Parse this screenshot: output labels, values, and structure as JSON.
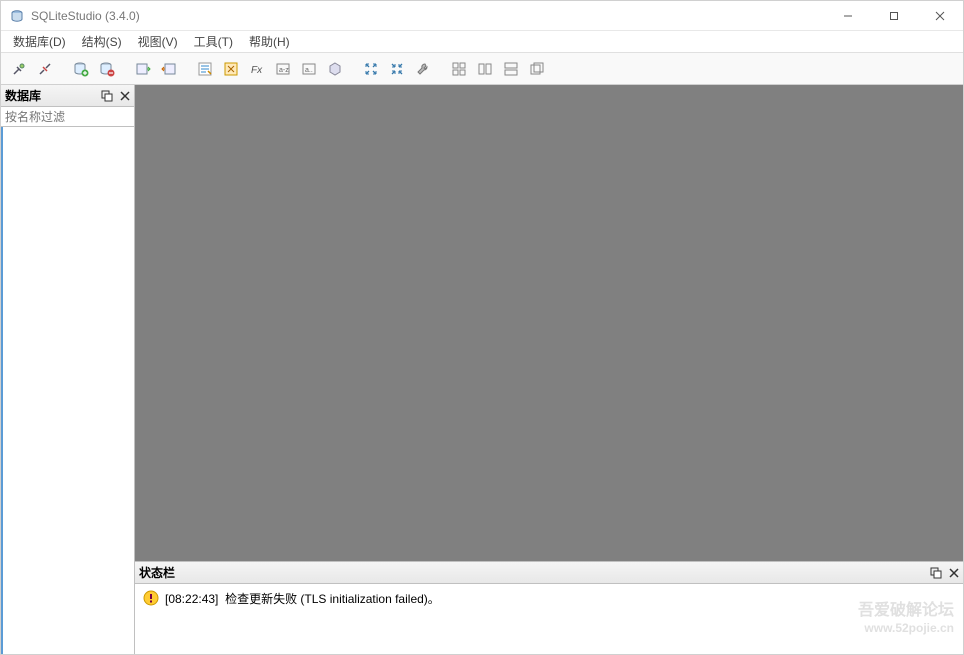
{
  "window": {
    "title": "SQLiteStudio (3.4.0)"
  },
  "menu": {
    "database": "数据库(D)",
    "structure": "结构(S)",
    "view": "视图(V)",
    "tools": "工具(T)",
    "help": "帮助(H)"
  },
  "toolbar": {
    "icons": [
      "connect-icon",
      "disconnect-icon",
      "add-db-icon",
      "remove-db-icon",
      "import-icon",
      "export-icon",
      "sql-editor-icon",
      "sql-function-icon",
      "fx-icon",
      "collation-icon",
      "extension-icon",
      "ddl-icon",
      "maximize-icon",
      "restore-icon",
      "wrench-icon",
      "layout-grid-icon",
      "layout-split-icon",
      "layout-rows-icon",
      "layout-copy-icon"
    ]
  },
  "panels": {
    "database_title": "数据库",
    "filter_placeholder": "按名称过滤",
    "status_title": "状态栏"
  },
  "status": {
    "timestamp": "[08:22:43]",
    "message": "检查更新失败 (TLS initialization failed)。"
  },
  "watermark": {
    "line1": "吾爱破解论坛",
    "line2": "www.52pojie.cn"
  }
}
